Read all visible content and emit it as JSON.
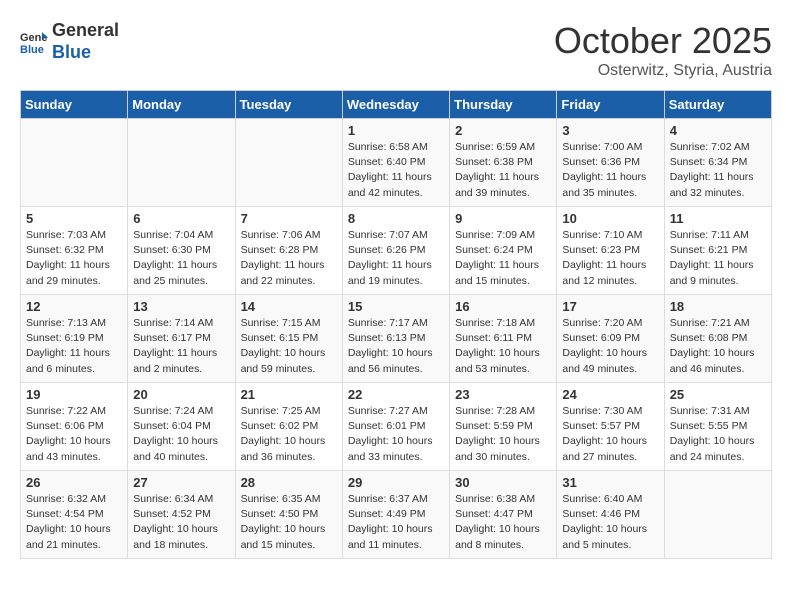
{
  "header": {
    "logo_line1": "General",
    "logo_line2": "Blue",
    "month": "October 2025",
    "location": "Osterwitz, Styria, Austria"
  },
  "days_of_week": [
    "Sunday",
    "Monday",
    "Tuesday",
    "Wednesday",
    "Thursday",
    "Friday",
    "Saturday"
  ],
  "weeks": [
    [
      {
        "day": "",
        "info": ""
      },
      {
        "day": "",
        "info": ""
      },
      {
        "day": "",
        "info": ""
      },
      {
        "day": "1",
        "info": "Sunrise: 6:58 AM\nSunset: 6:40 PM\nDaylight: 11 hours\nand 42 minutes."
      },
      {
        "day": "2",
        "info": "Sunrise: 6:59 AM\nSunset: 6:38 PM\nDaylight: 11 hours\nand 39 minutes."
      },
      {
        "day": "3",
        "info": "Sunrise: 7:00 AM\nSunset: 6:36 PM\nDaylight: 11 hours\nand 35 minutes."
      },
      {
        "day": "4",
        "info": "Sunrise: 7:02 AM\nSunset: 6:34 PM\nDaylight: 11 hours\nand 32 minutes."
      }
    ],
    [
      {
        "day": "5",
        "info": "Sunrise: 7:03 AM\nSunset: 6:32 PM\nDaylight: 11 hours\nand 29 minutes."
      },
      {
        "day": "6",
        "info": "Sunrise: 7:04 AM\nSunset: 6:30 PM\nDaylight: 11 hours\nand 25 minutes."
      },
      {
        "day": "7",
        "info": "Sunrise: 7:06 AM\nSunset: 6:28 PM\nDaylight: 11 hours\nand 22 minutes."
      },
      {
        "day": "8",
        "info": "Sunrise: 7:07 AM\nSunset: 6:26 PM\nDaylight: 11 hours\nand 19 minutes."
      },
      {
        "day": "9",
        "info": "Sunrise: 7:09 AM\nSunset: 6:24 PM\nDaylight: 11 hours\nand 15 minutes."
      },
      {
        "day": "10",
        "info": "Sunrise: 7:10 AM\nSunset: 6:23 PM\nDaylight: 11 hours\nand 12 minutes."
      },
      {
        "day": "11",
        "info": "Sunrise: 7:11 AM\nSunset: 6:21 PM\nDaylight: 11 hours\nand 9 minutes."
      }
    ],
    [
      {
        "day": "12",
        "info": "Sunrise: 7:13 AM\nSunset: 6:19 PM\nDaylight: 11 hours\nand 6 minutes."
      },
      {
        "day": "13",
        "info": "Sunrise: 7:14 AM\nSunset: 6:17 PM\nDaylight: 11 hours\nand 2 minutes."
      },
      {
        "day": "14",
        "info": "Sunrise: 7:15 AM\nSunset: 6:15 PM\nDaylight: 10 hours\nand 59 minutes."
      },
      {
        "day": "15",
        "info": "Sunrise: 7:17 AM\nSunset: 6:13 PM\nDaylight: 10 hours\nand 56 minutes."
      },
      {
        "day": "16",
        "info": "Sunrise: 7:18 AM\nSunset: 6:11 PM\nDaylight: 10 hours\nand 53 minutes."
      },
      {
        "day": "17",
        "info": "Sunrise: 7:20 AM\nSunset: 6:09 PM\nDaylight: 10 hours\nand 49 minutes."
      },
      {
        "day": "18",
        "info": "Sunrise: 7:21 AM\nSunset: 6:08 PM\nDaylight: 10 hours\nand 46 minutes."
      }
    ],
    [
      {
        "day": "19",
        "info": "Sunrise: 7:22 AM\nSunset: 6:06 PM\nDaylight: 10 hours\nand 43 minutes."
      },
      {
        "day": "20",
        "info": "Sunrise: 7:24 AM\nSunset: 6:04 PM\nDaylight: 10 hours\nand 40 minutes."
      },
      {
        "day": "21",
        "info": "Sunrise: 7:25 AM\nSunset: 6:02 PM\nDaylight: 10 hours\nand 36 minutes."
      },
      {
        "day": "22",
        "info": "Sunrise: 7:27 AM\nSunset: 6:01 PM\nDaylight: 10 hours\nand 33 minutes."
      },
      {
        "day": "23",
        "info": "Sunrise: 7:28 AM\nSunset: 5:59 PM\nDaylight: 10 hours\nand 30 minutes."
      },
      {
        "day": "24",
        "info": "Sunrise: 7:30 AM\nSunset: 5:57 PM\nDaylight: 10 hours\nand 27 minutes."
      },
      {
        "day": "25",
        "info": "Sunrise: 7:31 AM\nSunset: 5:55 PM\nDaylight: 10 hours\nand 24 minutes."
      }
    ],
    [
      {
        "day": "26",
        "info": "Sunrise: 6:32 AM\nSunset: 4:54 PM\nDaylight: 10 hours\nand 21 minutes."
      },
      {
        "day": "27",
        "info": "Sunrise: 6:34 AM\nSunset: 4:52 PM\nDaylight: 10 hours\nand 18 minutes."
      },
      {
        "day": "28",
        "info": "Sunrise: 6:35 AM\nSunset: 4:50 PM\nDaylight: 10 hours\nand 15 minutes."
      },
      {
        "day": "29",
        "info": "Sunrise: 6:37 AM\nSunset: 4:49 PM\nDaylight: 10 hours\nand 11 minutes."
      },
      {
        "day": "30",
        "info": "Sunrise: 6:38 AM\nSunset: 4:47 PM\nDaylight: 10 hours\nand 8 minutes."
      },
      {
        "day": "31",
        "info": "Sunrise: 6:40 AM\nSunset: 4:46 PM\nDaylight: 10 hours\nand 5 minutes."
      },
      {
        "day": "",
        "info": ""
      }
    ]
  ]
}
